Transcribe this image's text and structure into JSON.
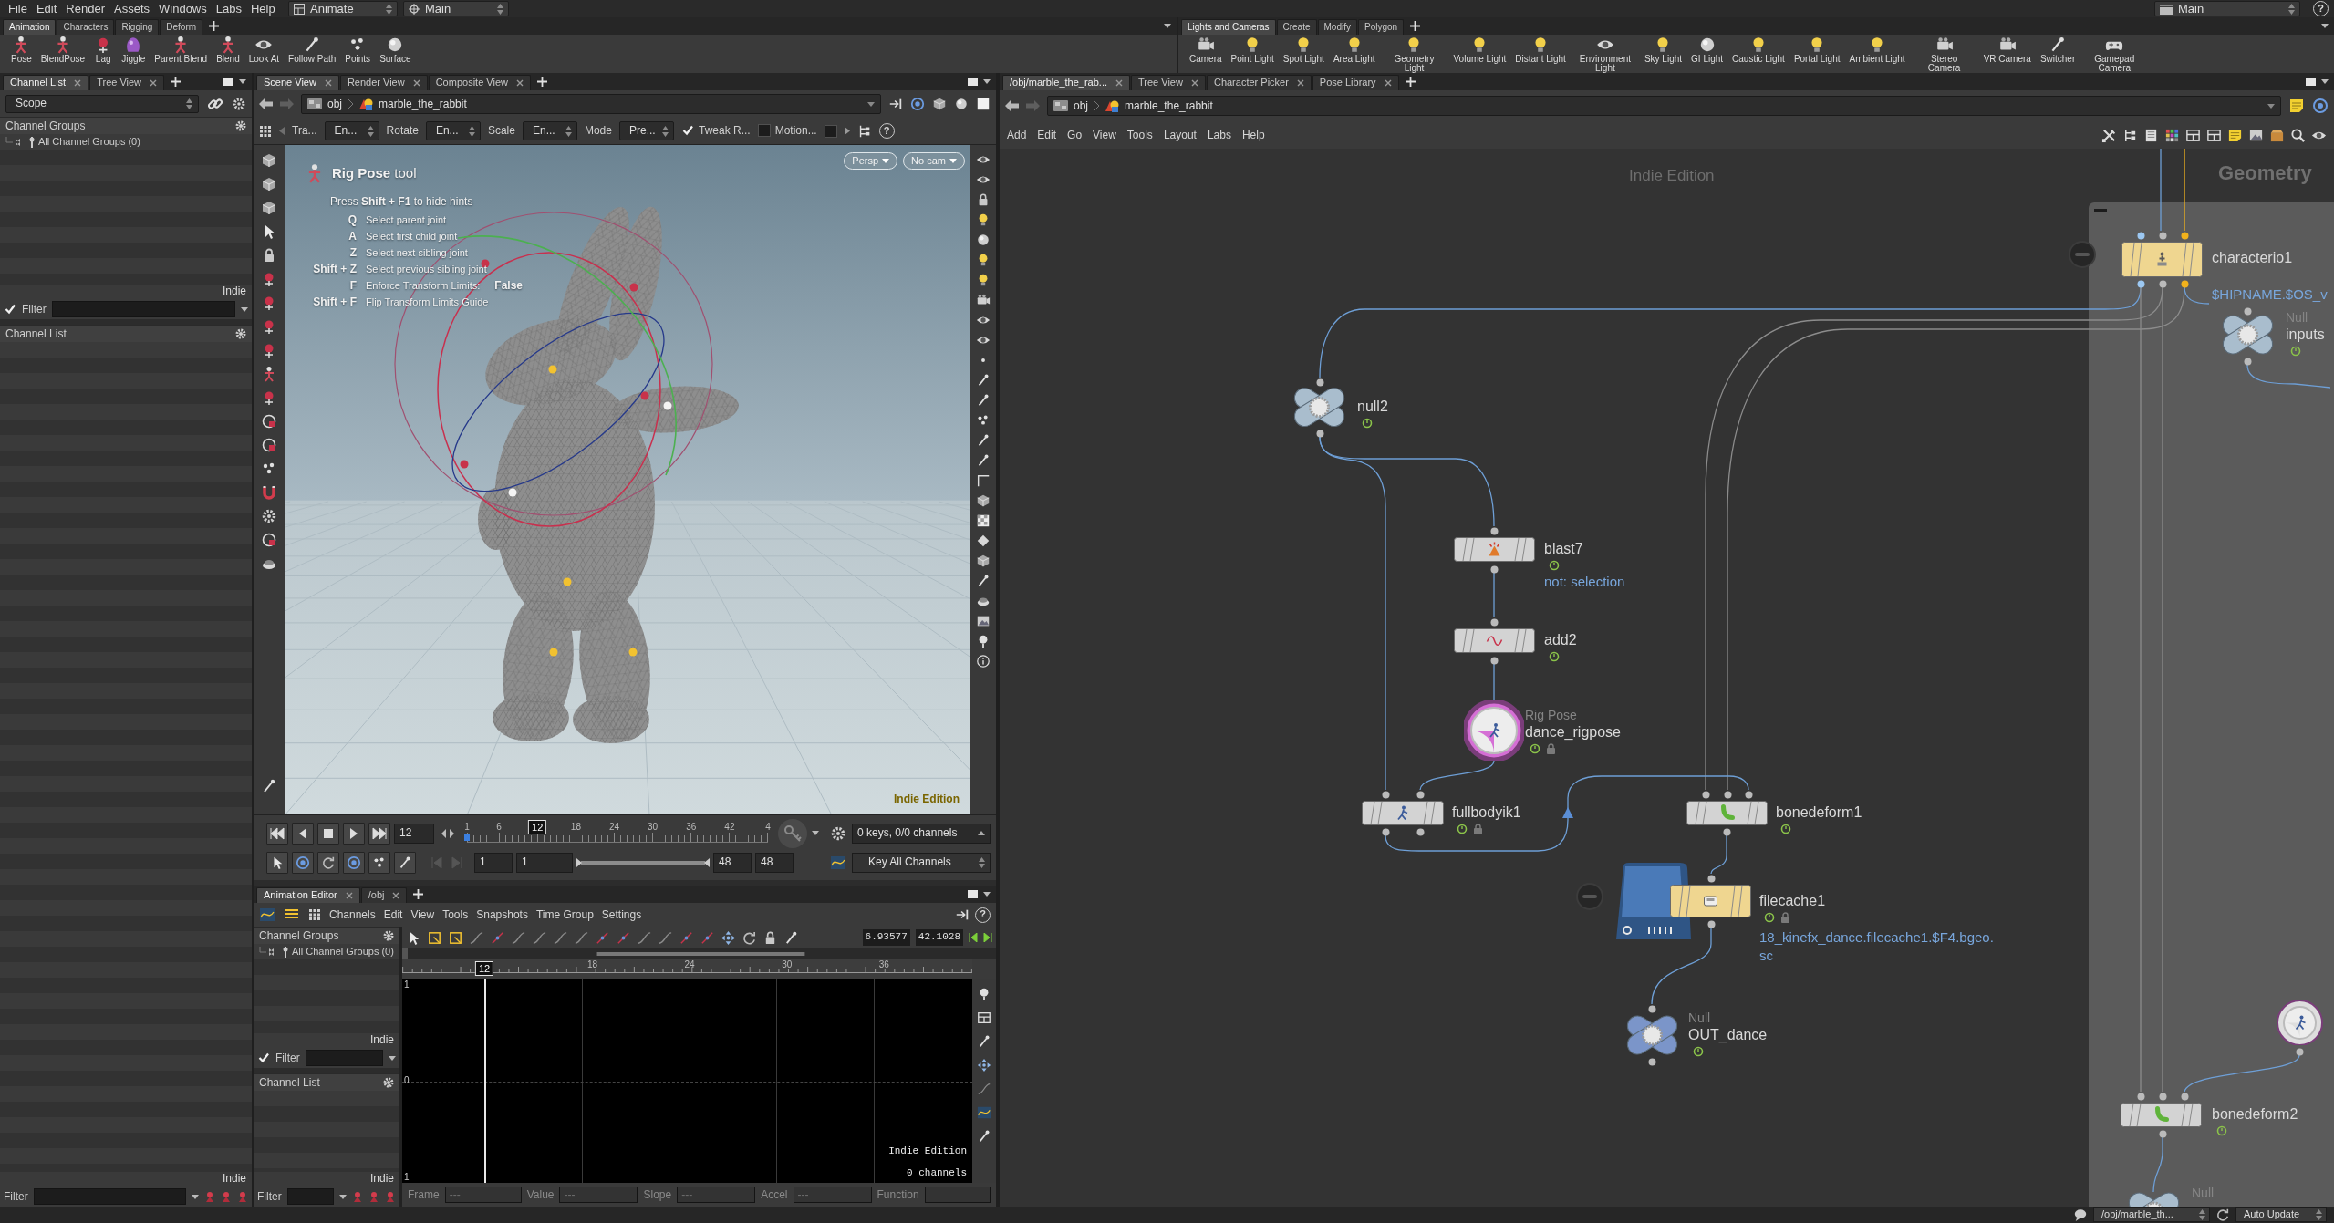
{
  "menu_bar": {
    "items": [
      "File",
      "Edit",
      "Render",
      "Assets",
      "Windows",
      "Labs",
      "Help"
    ],
    "desktop": "Animate",
    "context": "Main",
    "right_desktop": "Main",
    "help": "?"
  },
  "shelves": [
    {
      "tabs": [
        {
          "label": "Animation",
          "selected": true
        },
        {
          "label": "Characters",
          "selected": false
        },
        {
          "label": "Rigging",
          "selected": false
        },
        {
          "label": "Deform",
          "selected": false
        }
      ],
      "tools": [
        "Pose",
        "BlendPose",
        "Lag",
        "Jiggle",
        "Parent Blend",
        "Blend",
        "Look At",
        "Follow Path",
        "Points",
        "Surface"
      ]
    },
    {
      "tabs": [
        {
          "label": "Lights and Cameras",
          "selected": true
        },
        {
          "label": "Create",
          "selected": false
        },
        {
          "label": "Modify",
          "selected": false
        },
        {
          "label": "Polygon",
          "selected": false
        }
      ],
      "tools": [
        "Camera",
        "Point Light",
        "Spot Light",
        "Area Light",
        "Geometry Light",
        "Volume Light",
        "Distant Light",
        "Environment Light",
        "Sky Light",
        "GI Light",
        "Caustic Light",
        "Portal Light",
        "Ambient Light",
        "Stereo Camera",
        "VR Camera",
        "Switcher",
        "Gamepad Camera"
      ]
    }
  ],
  "channel_pane": {
    "tabs": [
      {
        "label": "Channel List",
        "selected": true
      },
      {
        "label": "Tree View",
        "selected": false
      }
    ],
    "scope": "Scope",
    "groups_title": "Channel Groups",
    "groups": [
      "All Channel Groups (0)"
    ],
    "groups_edition": "Indie",
    "groups_filter": {
      "label": "Filter",
      "checked": true
    },
    "list_title": "Channel List",
    "list_edition": "Indie",
    "list_filter": {
      "label": "Filter"
    }
  },
  "scene_view": {
    "tabs": [
      {
        "label": "Scene View",
        "selected": true
      },
      {
        "label": "Render View",
        "selected": false
      },
      {
        "label": "Composite View",
        "selected": false
      }
    ],
    "path": [
      "obj",
      "marble_the_rabbit"
    ],
    "toolbar": [
      {
        "kind": "label",
        "label": "Tra..."
      },
      {
        "kind": "dropdown",
        "label": "En..."
      },
      {
        "kind": "label",
        "label": "Rotate"
      },
      {
        "kind": "dropdown",
        "label": "En..."
      },
      {
        "kind": "label",
        "label": "Scale"
      },
      {
        "kind": "dropdown",
        "label": "En..."
      },
      {
        "kind": "label",
        "label": "Mode"
      },
      {
        "kind": "dropdown",
        "label": "Pre..."
      },
      {
        "kind": "checkbox",
        "label": "Tweak R...",
        "checked": true
      },
      {
        "kind": "checkbox",
        "label": "Motion...",
        "checked": false
      },
      {
        "kind": "checkbox",
        "checked": false
      }
    ],
    "help": "?",
    "hud": {
      "title": "**Rig Pose** tool",
      "intro": "Press **Shift + F1** to hide hints",
      "hints": [
        {
          "key": "Q",
          "text": "Select parent joint"
        },
        {
          "key": "A",
          "text": "Select first child joint"
        },
        {
          "key": "Z",
          "text": "Select next sibling joint"
        },
        {
          "key": "Shift + Z",
          "text": "Select previous sibling joint"
        },
        {
          "key": "F",
          "text": "Enforce Transform Limits:",
          "value": "False"
        },
        {
          "key": "Shift + F",
          "text": "Flip Transform Limits Guide"
        }
      ]
    },
    "camera_menus": [
      "Persp",
      "No cam"
    ],
    "edition": "Indie Edition"
  },
  "playbar": {
    "frame": "12",
    "ticks": [
      "1",
      "6",
      "18",
      "24",
      "30",
      "36",
      "42",
      "4"
    ],
    "playhead": {
      "label": "12",
      "level": 0.234
    },
    "start": "1",
    "range_start": "1",
    "range": {
      "level": 1
    },
    "range_end": "48",
    "end": "48",
    "keys": "0 keys, 0/0 channels",
    "key_mode": "Key All Channels"
  },
  "animation_editor": {
    "tabs": [
      {
        "label": "Animation Editor",
        "selected": true
      },
      {
        "label": "/obj",
        "selected": false
      }
    ],
    "menu": [
      "Channels",
      "Edit",
      "View",
      "Tools",
      "Snapshots",
      "Time Group",
      "Settings"
    ],
    "help": "?",
    "groups_title": "Channel Groups",
    "groups": [
      "All Channel Groups (0)"
    ],
    "groups_edition": "Indie",
    "groups_filter": {
      "label": "Filter",
      "checked": true
    },
    "list_title": "Channel List",
    "list_edition": "Indie",
    "list_filter": {
      "label": "Filter"
    },
    "view_range": [
      "6.93577",
      "42.1028"
    ],
    "ruler": [
      "18",
      "24",
      "30",
      "36"
    ],
    "playhead": {
      "label": "12",
      "level": 0.144
    },
    "value_labels": [
      "1",
      "0",
      "1"
    ],
    "overlay": [
      "Indie Edition",
      "0 channels"
    ],
    "fields": [
      {
        "label": "Frame",
        "placeholder": "---"
      },
      {
        "label": "Value",
        "placeholder": "---"
      },
      {
        "label": "Slope",
        "placeholder": "---"
      },
      {
        "label": "Accel",
        "placeholder": "---"
      },
      {
        "label": "Function"
      }
    ]
  },
  "network": {
    "tabs": [
      {
        "label": "/obj/marble_the_rab...",
        "selected": true
      },
      {
        "label": "Tree View",
        "selected": false
      },
      {
        "label": "Character Picker",
        "selected": false
      },
      {
        "label": "Pose Library",
        "selected": false
      }
    ],
    "path": [
      "obj",
      "marble_the_rabbit"
    ],
    "menu": [
      "Add",
      "Edit",
      "Go",
      "View",
      "Tools",
      "Layout",
      "Labs",
      "Help"
    ],
    "edition": "Indie Edition",
    "box_title": "Geometry",
    "nodes": [
      {
        "kind": "null",
        "name": "null2",
        "color": "#a9bdcd",
        "cooked": true,
        "locked": false,
        "collapsed": false
      },
      {
        "kind": "box",
        "name": "blast7",
        "comment": "not: selection",
        "color": "#d3d3d3",
        "cooked": true,
        "locked": false,
        "collapsed": false
      },
      {
        "kind": "box",
        "name": "add2",
        "color": "#d3d3d3",
        "cooked": true,
        "locked": false,
        "collapsed": false
      },
      {
        "kind": "circle",
        "type": "Rig Pose",
        "name": "dance_rigpose",
        "color": "#d56fd5",
        "cooked": true,
        "locked": true,
        "collapsed": false
      },
      {
        "kind": "box",
        "name": "fullbodyik1",
        "color": "#d3d3d3",
        "cooked": true,
        "locked": true,
        "collapsed": false
      },
      {
        "kind": "box",
        "name": "bonedeform1",
        "color": "#d3d3d3",
        "cooked": true,
        "locked": false,
        "collapsed": false
      },
      {
        "kind": "filecache",
        "name": "filecache1",
        "comment": "18_kinefx_dance.filecache1.$F4.bgeo.sc",
        "color": "#efd690",
        "cooked": true,
        "locked": true,
        "collapsed": true
      },
      {
        "kind": "null",
        "type": "Null",
        "name": "OUT_dance",
        "color": "#7b95c9",
        "cooked": true,
        "locked": false,
        "collapsed": false
      },
      {
        "kind": "box",
        "name": "characterio1",
        "comment": "$HIPNAME.$OS_v",
        "color": "#efd690",
        "cooked": false,
        "locked": false,
        "collapsed": true
      },
      {
        "kind": "null",
        "type": "Null",
        "name": "inputs",
        "color": "#a9bdcd",
        "cooked": true,
        "locked": false,
        "collapsed": false
      },
      {
        "kind": "circle",
        "color": "#dedede"
      },
      {
        "kind": "box",
        "name": "bonedeform2",
        "color": "#d3d3d3",
        "cooked": true,
        "locked": false,
        "collapsed": false
      },
      {
        "kind": "null",
        "type": "Null",
        "color": "#a9bdcd"
      }
    ]
  },
  "status_bar": {
    "path": "/obj/marble_th...",
    "update_mode": "Auto Update"
  }
}
